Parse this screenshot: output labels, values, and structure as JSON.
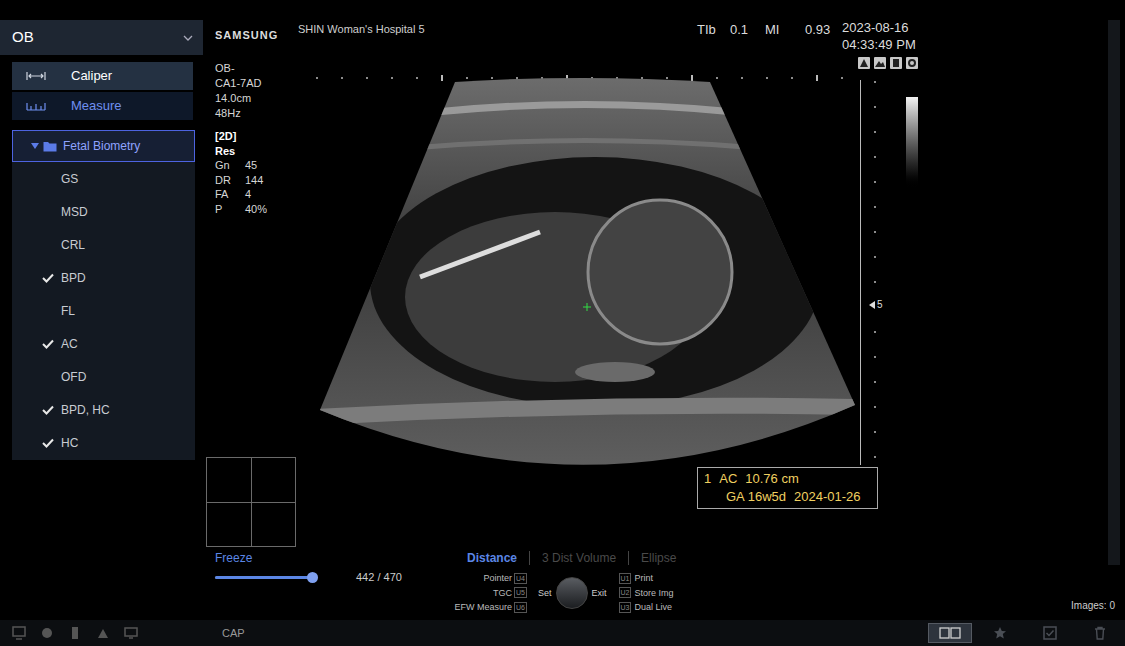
{
  "mode_menu": {
    "label": "OB"
  },
  "tools": [
    {
      "label": "Caliper",
      "selected": false
    },
    {
      "label": "Measure",
      "selected": true
    }
  ],
  "measure_folder": {
    "label": "Fetal Biometry",
    "expanded": true,
    "selected": true
  },
  "measure_items": [
    {
      "label": "GS",
      "checked": false
    },
    {
      "label": "MSD",
      "checked": false
    },
    {
      "label": "CRL",
      "checked": false
    },
    {
      "label": "BPD",
      "checked": true
    },
    {
      "label": "FL",
      "checked": false
    },
    {
      "label": "AC",
      "checked": true
    },
    {
      "label": "OFD",
      "checked": false
    },
    {
      "label": "BPD, HC",
      "checked": true
    },
    {
      "label": "HC",
      "checked": true
    }
  ],
  "header": {
    "brand": "SAMSUNG",
    "hospital": "SHIN Woman's Hospital 5",
    "readouts": [
      {
        "label": "TIb",
        "value": "0.1"
      },
      {
        "label": "MI",
        "value": "0.93"
      }
    ],
    "date": "2023-08-16",
    "time": "04:33:49 PM"
  },
  "probe_info": [
    "OB-",
    "CA1-7AD",
    "14.0cm",
    "48Hz"
  ],
  "image_mode": "[2D]",
  "preset": "Res",
  "params": [
    {
      "label": "Gn",
      "value": "45"
    },
    {
      "label": "DR",
      "value": "144"
    },
    {
      "label": "FA",
      "value": "4"
    },
    {
      "label": "P",
      "value": "40%"
    }
  ],
  "depth_marker": "5",
  "measurement": {
    "index": "1",
    "label": "AC",
    "value": "10.76 cm",
    "ga": "GA 16w5d",
    "edd": "2024-01-26"
  },
  "cine": {
    "label": "Freeze",
    "level": 0.94,
    "frame": "442 / 470"
  },
  "caliper_modes": [
    {
      "label": "Distance",
      "selected": true
    },
    {
      "label": "3 Dist Volume",
      "selected": false
    },
    {
      "label": "Ellipse",
      "selected": false
    }
  ],
  "soft_keys_left": [
    {
      "label": "Pointer",
      "key": "U4"
    },
    {
      "label": "TGC",
      "key": "U5"
    },
    {
      "label": "EFW Measure",
      "key": "U6"
    }
  ],
  "knob": {
    "left": "Set",
    "right": "Exit"
  },
  "soft_keys_right": [
    {
      "key": "U1",
      "label": "Print"
    },
    {
      "key": "U2",
      "label": "Store Img"
    },
    {
      "key": "U3",
      "label": "Dual Live"
    }
  ],
  "images_count": "Images: 0",
  "status_bar": {
    "cap": "CAP"
  },
  "view_buttons": [
    {
      "kind": "dual",
      "selected": true
    },
    {
      "kind": "favorite",
      "selected": false
    },
    {
      "kind": "check",
      "selected": false
    },
    {
      "kind": "delete",
      "selected": false
    }
  ]
}
